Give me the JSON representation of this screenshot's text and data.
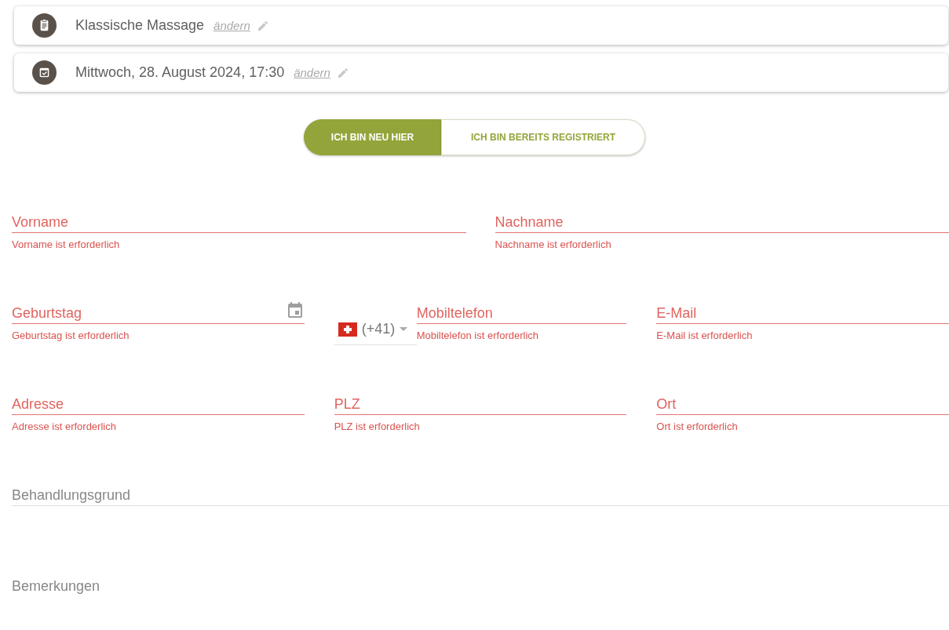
{
  "summary": [
    {
      "kind": "service",
      "text": "Klassische Massage",
      "link": "ändern"
    },
    {
      "kind": "date",
      "text": "Mittwoch, 28. August 2024, 17:30",
      "link": "ändern"
    }
  ],
  "toggle": [
    {
      "label": "ICH BIN NEU HIER",
      "selected": true
    },
    {
      "label": "ICH BIN BEREITS REGISTRIERT",
      "selected": false
    }
  ],
  "form_rows": [
    [
      {
        "kind": "text",
        "placeholder": "Vorname",
        "error": true,
        "message": "Vorname ist erforderlich"
      },
      {
        "kind": "text",
        "placeholder": "Nachname",
        "error": true,
        "message": "Nachname ist erforderlich"
      }
    ],
    [
      {
        "kind": "date",
        "placeholder": "Geburtstag",
        "error": true,
        "message": "Geburtstag ist erforderlich"
      },
      {
        "kind": "phone",
        "country_code": "(+41)",
        "placeholder": "Mobiltelefon",
        "error": true,
        "message": "Mobiltelefon ist erforderlich"
      },
      {
        "kind": "text",
        "placeholder": "E-Mail",
        "error": true,
        "message": "E-Mail ist erforderlich"
      }
    ],
    [
      {
        "kind": "text",
        "placeholder": "Adresse",
        "error": true,
        "message": "Adresse ist erforderlich"
      },
      {
        "kind": "text",
        "placeholder": "PLZ",
        "error": true,
        "message": "PLZ ist erforderlich"
      },
      {
        "kind": "text",
        "placeholder": "Ort",
        "error": true,
        "message": "Ort ist erforderlich"
      }
    ],
    [
      {
        "kind": "text",
        "placeholder": "Behandlungsgrund",
        "error": false
      }
    ],
    [
      {
        "kind": "plain",
        "placeholder": "Bemerkungen",
        "error": false
      }
    ]
  ]
}
